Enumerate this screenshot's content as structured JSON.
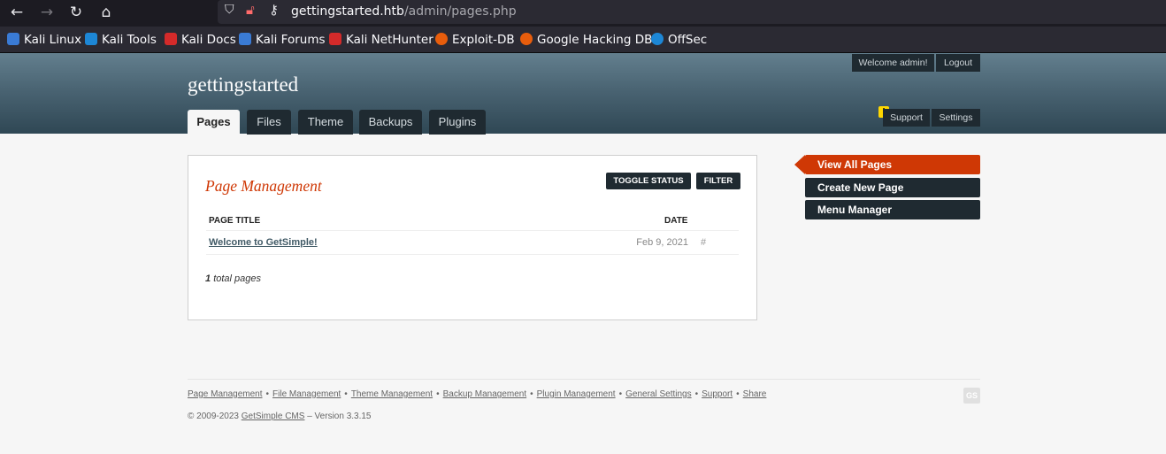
{
  "browser": {
    "url_host": "gettingstarted.htb",
    "url_path": "/admin/pages.php",
    "bookmarks": [
      {
        "label": "Kali Linux",
        "color": "#3a7bd5"
      },
      {
        "label": "Kali Tools",
        "color": "#1d87d6"
      },
      {
        "label": "Kali Docs",
        "color": "#d42a2a"
      },
      {
        "label": "Kali Forums",
        "color": "#3a7bd5"
      },
      {
        "label": "Kali NetHunter",
        "color": "#d42a2a"
      },
      {
        "label": "Exploit-DB",
        "color": "#e85d0c"
      },
      {
        "label": "Google Hacking DB",
        "color": "#e85d0c"
      },
      {
        "label": "OffSec",
        "color": "#1d87d6"
      }
    ]
  },
  "header": {
    "site_name": "gettingstarted",
    "welcome": "Welcome admin!",
    "logout": "Logout",
    "support": "Support",
    "settings": "Settings",
    "warning": "!",
    "tabs": [
      "Pages",
      "Files",
      "Theme",
      "Backups",
      "Plugins"
    ]
  },
  "main": {
    "title": "Page Management",
    "toggle_status": "TOGGLE STATUS",
    "filter": "FILTER",
    "col_title": "PAGE TITLE",
    "col_date": "DATE",
    "rows": [
      {
        "title": "Welcome to GetSimple!",
        "date": "Feb 9, 2021",
        "link": "#"
      }
    ],
    "total_count": "1",
    "total_label": "total pages"
  },
  "sidebar": [
    "View All Pages",
    "Create New Page",
    "Menu Manager"
  ],
  "footer": {
    "links": [
      "Page Management",
      "File Management",
      "Theme Management",
      "Backup Management",
      "Plugin Management",
      "General Settings",
      "Support",
      "Share"
    ],
    "sep": "•",
    "copy_prefix": "© 2009-2023",
    "cms_name": "GetSimple CMS",
    "version": "– Version 3.3.15",
    "logo": "GS"
  },
  "colors": {
    "accent": "#cf3805",
    "dark": "#1f2a31",
    "header_top": "#637f8e"
  }
}
